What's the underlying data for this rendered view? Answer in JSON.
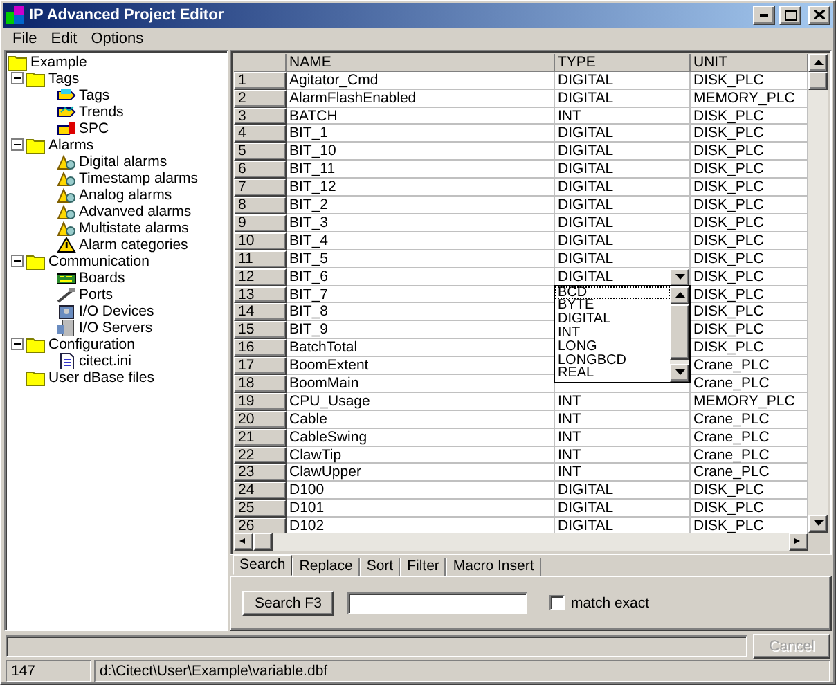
{
  "window": {
    "title": "IP Advanced Project Editor"
  },
  "menu": [
    "File",
    "Edit",
    "Options"
  ],
  "tree": [
    {
      "label": "Example",
      "kind": "folder",
      "children": [
        {
          "label": "Tags",
          "kind": "folder",
          "expanded": true,
          "children": [
            {
              "label": "Tags",
              "kind": "tag"
            },
            {
              "label": "Trends",
              "kind": "trend"
            },
            {
              "label": "SPC",
              "kind": "spc"
            }
          ]
        },
        {
          "label": "Alarms",
          "kind": "folder",
          "expanded": true,
          "children": [
            {
              "label": "Digital alarms",
              "kind": "alarm"
            },
            {
              "label": "Timestamp alarms",
              "kind": "alarm"
            },
            {
              "label": "Analog alarms",
              "kind": "alarm"
            },
            {
              "label": "Advanved alarms",
              "kind": "alarm"
            },
            {
              "label": "Multistate alarms",
              "kind": "alarm"
            },
            {
              "label": "Alarm categories",
              "kind": "warning"
            }
          ]
        },
        {
          "label": "Communication",
          "kind": "folder",
          "expanded": true,
          "children": [
            {
              "label": "Boards",
              "kind": "board"
            },
            {
              "label": "Ports",
              "kind": "port"
            },
            {
              "label": "I/O Devices",
              "kind": "device"
            },
            {
              "label": "I/O Servers",
              "kind": "server"
            }
          ]
        },
        {
          "label": "Configuration",
          "kind": "folder",
          "expanded": true,
          "children": [
            {
              "label": "citect.ini",
              "kind": "file"
            }
          ]
        },
        {
          "label": "User dBase files",
          "kind": "folder"
        }
      ]
    }
  ],
  "table": {
    "columns": [
      "NAME",
      "TYPE",
      "UNIT"
    ],
    "rows": [
      {
        "n": "1",
        "name": "Agitator_Cmd",
        "type": "DIGITAL",
        "unit": "DISK_PLC"
      },
      {
        "n": "2",
        "name": "AlarmFlashEnabled",
        "type": "DIGITAL",
        "unit": "MEMORY_PLC"
      },
      {
        "n": "3",
        "name": "BATCH",
        "type": "INT",
        "unit": "DISK_PLC"
      },
      {
        "n": "4",
        "name": "BIT_1",
        "type": "DIGITAL",
        "unit": "DISK_PLC"
      },
      {
        "n": "5",
        "name": "BIT_10",
        "type": "DIGITAL",
        "unit": "DISK_PLC"
      },
      {
        "n": "6",
        "name": "BIT_11",
        "type": "DIGITAL",
        "unit": "DISK_PLC"
      },
      {
        "n": "7",
        "name": "BIT_12",
        "type": "DIGITAL",
        "unit": "DISK_PLC"
      },
      {
        "n": "8",
        "name": "BIT_2",
        "type": "DIGITAL",
        "unit": "DISK_PLC"
      },
      {
        "n": "9",
        "name": "BIT_3",
        "type": "DIGITAL",
        "unit": "DISK_PLC"
      },
      {
        "n": "10",
        "name": "BIT_4",
        "type": "DIGITAL",
        "unit": "DISK_PLC"
      },
      {
        "n": "11",
        "name": "BIT_5",
        "type": "DIGITAL",
        "unit": "DISK_PLC"
      },
      {
        "n": "12",
        "name": "BIT_6",
        "type": "DIGITAL",
        "unit": "DISK_PLC",
        "editing": true
      },
      {
        "n": "13",
        "name": "BIT_7",
        "unit": "DISK_PLC"
      },
      {
        "n": "14",
        "name": "BIT_8",
        "unit": "DISK_PLC"
      },
      {
        "n": "15",
        "name": "BIT_9",
        "unit": "DISK_PLC"
      },
      {
        "n": "16",
        "name": "BatchTotal",
        "unit": "DISK_PLC"
      },
      {
        "n": "17",
        "name": "BoomExtent",
        "unit": "Crane_PLC"
      },
      {
        "n": "18",
        "name": "BoomMain",
        "unit": "Crane_PLC"
      },
      {
        "n": "19",
        "name": "CPU_Usage",
        "type": "INT",
        "unit": "MEMORY_PLC"
      },
      {
        "n": "20",
        "name": "Cable",
        "type": "INT",
        "unit": "Crane_PLC"
      },
      {
        "n": "21",
        "name": "CableSwing",
        "type": "INT",
        "unit": "Crane_PLC"
      },
      {
        "n": "22",
        "name": "ClawTip",
        "type": "INT",
        "unit": "Crane_PLC"
      },
      {
        "n": "23",
        "name": "ClawUpper",
        "type": "INT",
        "unit": "Crane_PLC"
      },
      {
        "n": "24",
        "name": "D100",
        "type": "DIGITAL",
        "unit": "DISK_PLC"
      },
      {
        "n": "25",
        "name": "D101",
        "type": "DIGITAL",
        "unit": "DISK_PLC"
      },
      {
        "n": "26",
        "name": "D102",
        "type": "DIGITAL",
        "unit": "DISK_PLC"
      }
    ]
  },
  "dropdown": [
    {
      "label": "BCD",
      "selected": true
    },
    {
      "label": "BYTE",
      "selected": false
    },
    {
      "label": "DIGITAL",
      "selected": false
    },
    {
      "label": "INT",
      "selected": false
    },
    {
      "label": "LONG",
      "selected": false
    },
    {
      "label": "LONGBCD",
      "selected": false
    },
    {
      "label": "REAL",
      "selected": false
    }
  ],
  "tabs": [
    {
      "label": "Search",
      "selected": true
    },
    {
      "label": "Replace",
      "selected": false
    },
    {
      "label": "Sort",
      "selected": false
    },
    {
      "label": "Filter",
      "selected": false
    },
    {
      "label": "Macro Insert",
      "selected": false
    }
  ],
  "search": {
    "button": "Search F3",
    "checkbox": {
      "label": "match exact",
      "checked": false
    }
  },
  "progress": {
    "level": 0
  },
  "cancel": {
    "label": "Cancel",
    "disabled": true
  },
  "status_bar": [
    "147",
    "d:\\Citect\\User\\Example\\variable.dbf"
  ]
}
